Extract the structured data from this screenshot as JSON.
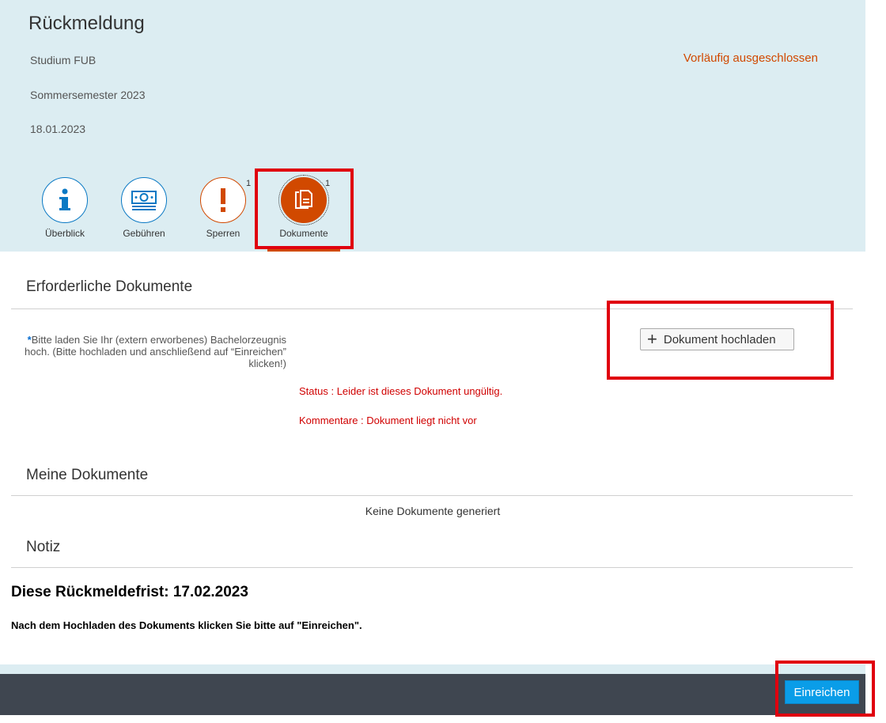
{
  "header": {
    "title": "Rückmeldung",
    "program": "Studium FUB",
    "semester": "Sommersemester 2023",
    "date": "18.01.2023",
    "status": "Vorläufig ausgeschlossen"
  },
  "tabs": [
    {
      "label": "Überblick",
      "icon": "info-icon",
      "badge": ""
    },
    {
      "label": "Gebühren",
      "icon": "money-icon",
      "badge": ""
    },
    {
      "label": "Sperren",
      "icon": "exclamation-icon",
      "badge": "1"
    },
    {
      "label": "Dokumente",
      "icon": "document-icon",
      "badge": "1"
    }
  ],
  "required": {
    "section_title": "Erforderliche Dokumente",
    "star": "*",
    "description": "Bitte laden Sie Ihr (extern erworbenes) Bachelorzeugnis hoch. (Bitte hochladen und anschließend auf “Einreichen” klicken!)",
    "upload_label": "Dokument hochladen",
    "status": "Status : Leider ist dieses Dokument ungültig.",
    "comment": "Kommentare : Dokument liegt nicht vor"
  },
  "my_documents": {
    "section_title": "Meine Dokumente",
    "empty_text": "Keine Dokumente generiert"
  },
  "note": {
    "section_title": "Notiz",
    "deadline": "Diese Rückmeldefrist: 17.02.2023",
    "hint": "Nach dem Hochladen des Dokuments klicken Sie bitte auf \"Einreichen\"."
  },
  "footer": {
    "submit_label": "Einreichen"
  },
  "colors": {
    "accent": "#d14900",
    "header_bg": "#dcedf2",
    "primary_button": "#0a9de8",
    "error": "#d00000"
  }
}
